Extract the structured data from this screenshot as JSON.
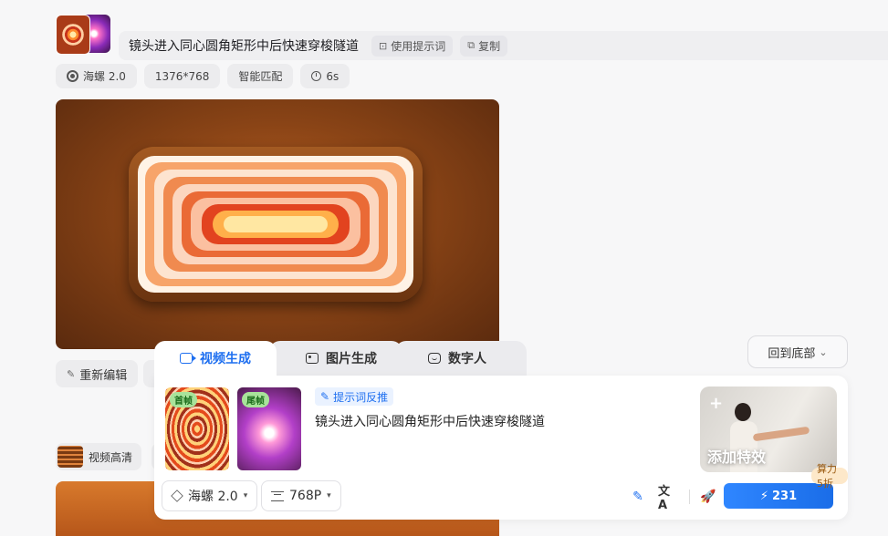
{
  "record": {
    "prompt": "镜头进入同心圆角矩形中后快速穿梭隧道",
    "use_prompt_label": "使用提示词",
    "copy_label": "复制",
    "meta": {
      "model": "海螺 2.0",
      "resolution": "1376*768",
      "ratio": "智能匹配",
      "duration": "6s"
    },
    "re_edit_label": "重新编辑",
    "hd_label": "视频高清"
  },
  "back_to_bottom": "回到底部",
  "panel": {
    "tabs": [
      {
        "label": "视频生成",
        "icon": "video-icon",
        "active": true
      },
      {
        "label": "图片生成",
        "icon": "image-icon",
        "active": false
      },
      {
        "label": "数字人",
        "icon": "avatar-icon",
        "active": false
      }
    ],
    "first_frame_tag": "首帧",
    "last_frame_tag": "尾帧",
    "reverse_prompt_label": "提示词反推",
    "prompt": "镜头进入同心圆角矩形中后快速穿梭隧道",
    "add_effect_label": "添加特效",
    "model_select": "海螺 2.0",
    "resolution_select": "768P",
    "discount_badge": "算力5折",
    "generate_cost": "231",
    "colors": {
      "accent": "#1e6ff0",
      "badge_bg": "#fde8c9"
    }
  }
}
